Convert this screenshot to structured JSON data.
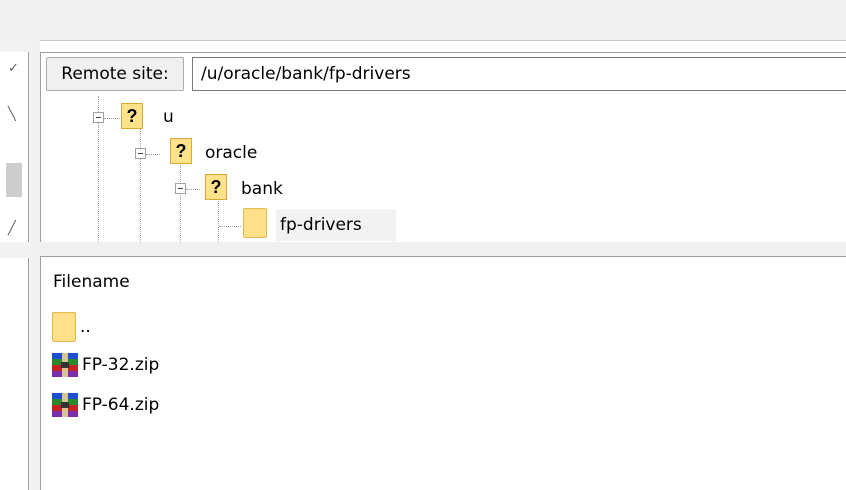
{
  "remote": {
    "label": "Remote site:",
    "path": "/u/oracle/bank/fp-drivers"
  },
  "tree": {
    "nodes": [
      {
        "label": "u",
        "icon": "question-folder-icon",
        "level": 0
      },
      {
        "label": "oracle",
        "icon": "question-folder-icon",
        "level": 1
      },
      {
        "label": "bank",
        "icon": "question-folder-icon",
        "level": 2
      },
      {
        "label": "fp-drivers",
        "icon": "folder-icon",
        "level": 3,
        "selected": true
      }
    ]
  },
  "file_list": {
    "column_header": "Filename",
    "rows": [
      {
        "name": "..",
        "icon": "folder-icon"
      },
      {
        "name": "FP-32.zip",
        "icon": "winrar-archive-icon"
      },
      {
        "name": "FP-64.zip",
        "icon": "winrar-archive-icon"
      }
    ]
  },
  "colors": {
    "folder": "#ffe08a",
    "question_icon": "#ffe38a",
    "panel_border": "#a0a0a0",
    "toolbar_bg": "#f0f0f0"
  }
}
